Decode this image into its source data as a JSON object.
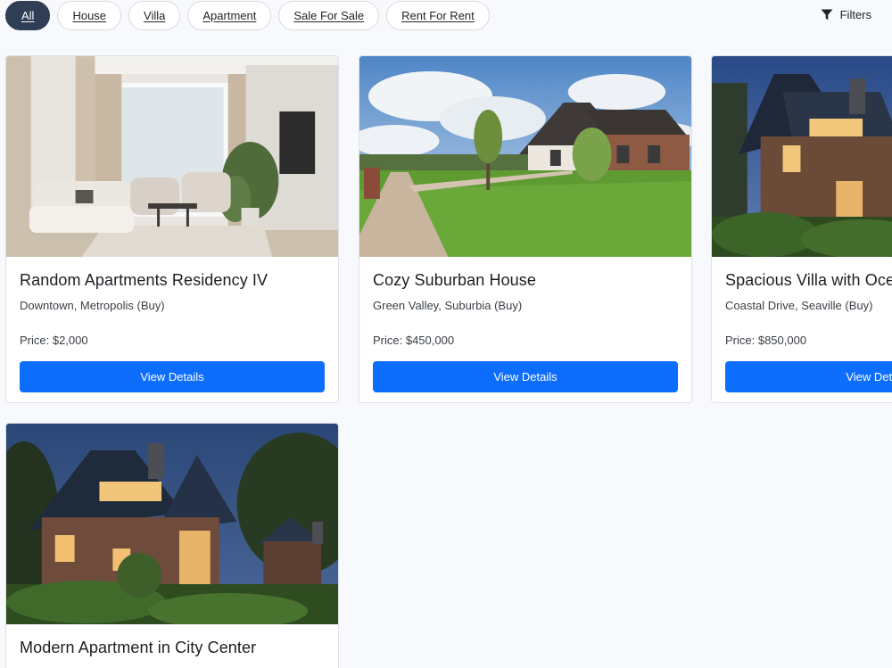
{
  "filters": {
    "pills": [
      {
        "label": "All",
        "active": true
      },
      {
        "label": "House",
        "active": false
      },
      {
        "label": "Villa",
        "active": false
      },
      {
        "label": "Apartment",
        "active": false
      },
      {
        "label": "Sale For Sale",
        "active": false
      },
      {
        "label": "Rent For Rent",
        "active": false
      }
    ],
    "filters_button_label": "Filters",
    "filters_icon": "funnel-icon"
  },
  "colors": {
    "active_pill": "#2f3d55",
    "primary_button": "#0d6efd",
    "page_background": "#f8f9fc"
  },
  "listings": [
    {
      "title": "Random Apartments Residency IV",
      "location": "Downtown, Metropolis (Buy)",
      "price": "Price: $2,000",
      "button_label": "View Details",
      "image": "living-room-photo"
    },
    {
      "title": "Cozy Suburban House",
      "location": "Green Valley, Suburbia (Buy)",
      "price": "Price: $450,000",
      "button_label": "View Details",
      "image": "suburban-house-photo"
    },
    {
      "title": "Spacious Villa with Ocean View",
      "location": "Coastal Drive, Seaville (Buy)",
      "price": "Price: $850,000",
      "button_label": "View Details",
      "image": "villa-night-photo"
    },
    {
      "title": "Modern Apartment in City Center",
      "location": "",
      "price": "",
      "button_label": "",
      "image": "house-night-photo"
    }
  ]
}
